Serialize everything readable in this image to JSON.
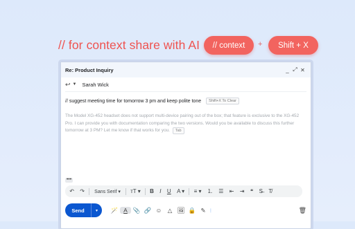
{
  "headline": "// for context share with AI",
  "pills": {
    "context": "// context",
    "plus": "+",
    "shortcut": "Shift + X"
  },
  "window": {
    "title": "Re: Product Inquiry",
    "controls": {
      "minimize": "_",
      "expand": "⤢",
      "close": "✕"
    },
    "recipient": "Sarah Wick",
    "prompt": "// suggest meeting time for tomorrow 3 pm and keep polite tone",
    "clear_hint": "Shift+X To Clear",
    "suggestion": "The Model XG-452 headset does not support multi-device pairing out of the box; that feature is exclusive to the XG-452 Pro. I can provide you with documentation comparing the two versions. Would you be available to discuss this further tomorrow at 3 PM? Let me know if that works for you.",
    "tab_hint": "Tab"
  },
  "toolbar": {
    "more": "•••",
    "undo": "↶",
    "redo": "↷",
    "font": "Sans Serif ▾",
    "size": "ᴛT ▾",
    "bold": "B",
    "italic": "I",
    "underline": "U",
    "text_color": "A ▾",
    "align": "≡ ▾",
    "numbered_list": "⒈",
    "bulleted_list": "☰",
    "indent_less": "⇤",
    "indent_more": "⇥",
    "quote": "❝",
    "strikethrough": "S̶",
    "clear_format": "T̸"
  },
  "bottom": {
    "send": "Send",
    "send_options": "▾",
    "icons": [
      "🪄",
      "A",
      "📎",
      "🔗",
      "☺",
      "△",
      "🖼",
      "🔒",
      "✎"
    ],
    "trash": "🗑"
  }
}
